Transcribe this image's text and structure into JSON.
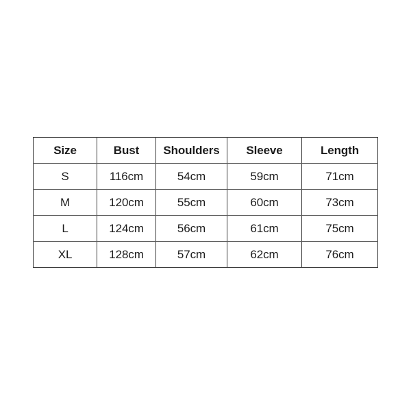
{
  "page": {
    "background_color": "#ffffff",
    "text_color": "#1c1c1c",
    "border_color_outer": "#3b3b3b",
    "border_color_inner": "#5e5e5e"
  },
  "size_chart": {
    "columns": [
      "Size",
      "Bust",
      "Shoulders",
      "Sleeve",
      "Length"
    ],
    "rows": [
      {
        "size": "S",
        "bust": "116cm",
        "shoulders": "54cm",
        "sleeve": "59cm",
        "length": "71cm"
      },
      {
        "size": "M",
        "bust": "120cm",
        "shoulders": "55cm",
        "sleeve": "60cm",
        "length": "73cm"
      },
      {
        "size": "L",
        "bust": "124cm",
        "shoulders": "56cm",
        "sleeve": "61cm",
        "length": "75cm"
      },
      {
        "size": "XL",
        "bust": "128cm",
        "shoulders": "57cm",
        "sleeve": "62cm",
        "length": "76cm"
      }
    ]
  }
}
